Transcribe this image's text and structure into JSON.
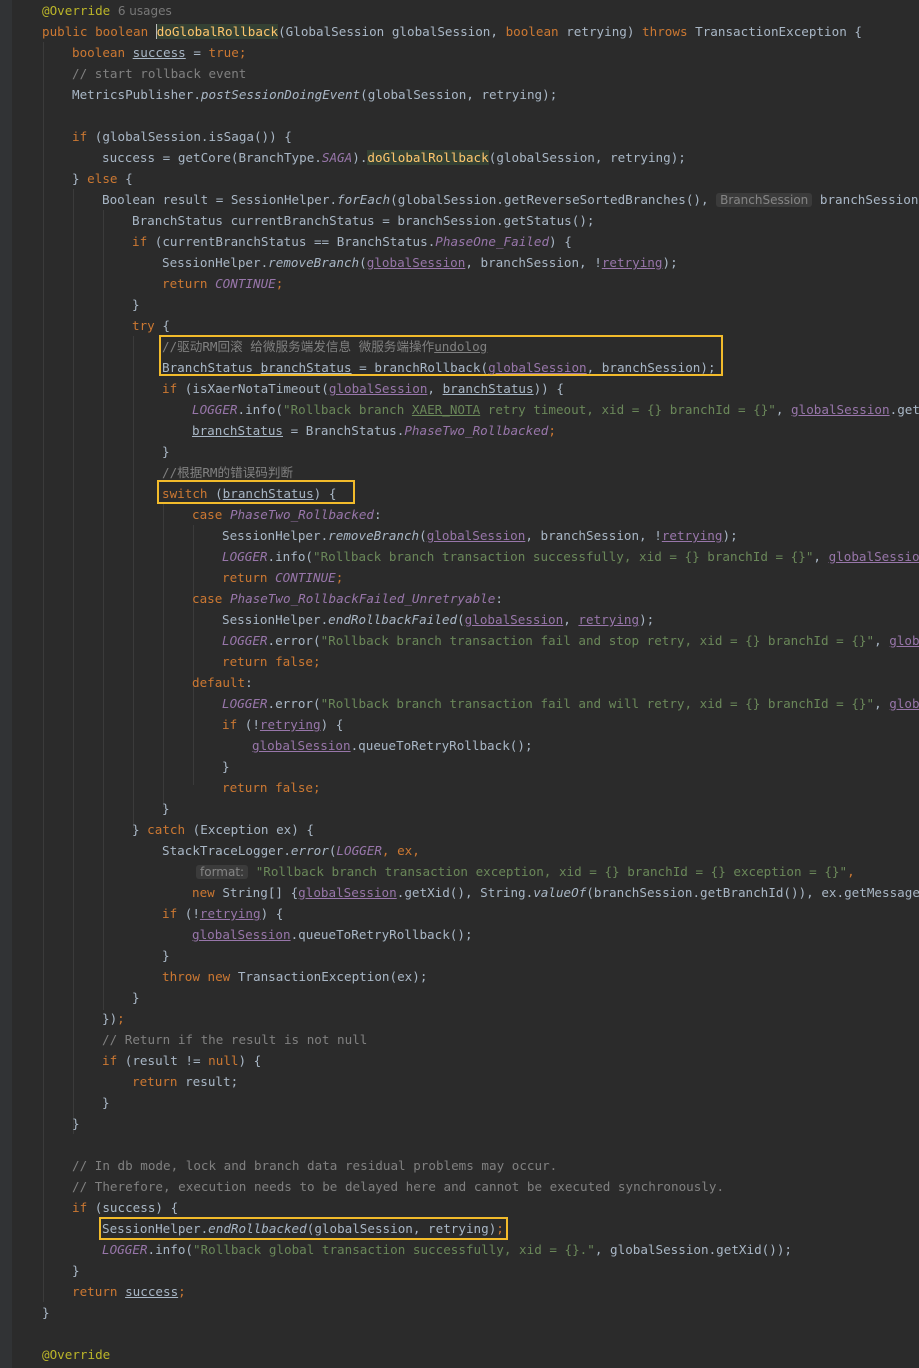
{
  "editor": {
    "usages_hint": "6 usages",
    "param_hint_branch": "BranchSession",
    "param_hint_format": "format:",
    "l1_annotation": "@Override",
    "l2_public": "public",
    "l2_boolean": "boolean",
    "l2_method": "doGlobalRollback",
    "l2_params_a": "(GlobalSession globalSession, ",
    "l2_boolean2": "boolean",
    "l2_params_b": " retrying) ",
    "l2_throws": "throws",
    "l2_rest": " TransactionException {",
    "l3_type": "boolean",
    "l3_var": "success",
    "l3_eq": " = ",
    "l3_true": "true",
    "l3_end": ";",
    "l4_comment": "// start rollback event",
    "l5_cls": "MetricsPublisher.",
    "l5_method": "postSessionDoingEvent",
    "l5_rest": "(globalSession, retrying);",
    "l7_if": "if",
    "l7_rest": " (globalSession.isSaga()) {",
    "l8_a": "success = getCore(BranchType.",
    "l8_saga": "SAGA",
    "l8_b": ").",
    "l8_method": "doGlobalRollback",
    "l8_c": "(globalSession, retrying);",
    "l9_a": "} ",
    "l9_else": "else",
    "l9_b": " {",
    "l10_a": "Boolean result = SessionHelper.",
    "l10_method": "forEach",
    "l10_b": "(globalSession.getReverseSortedBranches(), ",
    "l10_c": " branchSession",
    "l11": "BranchStatus currentBranchStatus = branchSession.getStatus();",
    "l12_if": "if",
    "l12_a": " (currentBranchStatus == BranchStatus.",
    "l12_const": "PhaseOne_Failed",
    "l12_b": ") {",
    "l13_a": "SessionHelper.",
    "l13_method": "removeBranch",
    "l13_b": "(",
    "l13_gs": "globalSession",
    "l13_c": ", branchSession, !",
    "l13_retry": "retrying",
    "l13_d": ");",
    "l14_return": "return",
    "l14_const": "CONTINUE",
    "l14_end": ";",
    "l15": "}",
    "l16_try": "try",
    "l16_b": " {",
    "l17_comment": "//驱动RM回滚 给微服务端发信息 微服务端操作",
    "l17_undolog": "undolog",
    "l18_a": "BranchStatus ",
    "l18_var": "branchStatus",
    "l18_b": " = branchRollback(",
    "l18_gs": "globalSession",
    "l18_c": ", branchSession);",
    "l19_if": "if",
    "l19_a": " (isXaerNotaTimeout(",
    "l19_gs": "globalSession",
    "l19_b": ", ",
    "l19_bs": "branchStatus",
    "l19_c": ")) {",
    "l20_logger": "LOGGER",
    "l20_a": ".info(",
    "l20_str1": "\"Rollback branch ",
    "l20_str_xaer": "XAER_NOTA",
    "l20_str2": " retry timeout, xid = {} branchId = {}\"",
    "l20_b": ", ",
    "l20_gs": "globalSession",
    "l20_c": ".getX",
    "l21_bs": "branchStatus",
    "l21_a": " = BranchStatus.",
    "l21_const": "PhaseTwo_Rollbacked",
    "l21_end": ";",
    "l22": "}",
    "l23_comment": "//根据RM的错误码判断",
    "l24_switch": "switch",
    "l24_a": " (",
    "l24_bs": "branchStatus",
    "l24_b": ") {",
    "l25_case": "case",
    "l25_const": "PhaseTwo_Rollbacked",
    "l25_b": ":",
    "l26_a": "SessionHelper.",
    "l26_method": "removeBranch",
    "l26_b": "(",
    "l26_gs": "globalSession",
    "l26_c": ", branchSession, !",
    "l26_retry": "retrying",
    "l26_d": ");",
    "l27_logger": "LOGGER",
    "l27_a": ".info(",
    "l27_str": "\"Rollback branch transaction successfully, xid = {} branchId = {}\"",
    "l27_b": ", ",
    "l27_gs": "globalSession",
    "l28_return": "return",
    "l28_const": "CONTINUE",
    "l28_end": ";",
    "l29_case": "case",
    "l29_const": "PhaseTwo_RollbackFailed_Unretryable",
    "l29_b": ":",
    "l30_a": "SessionHelper.",
    "l30_method": "endRollbackFailed",
    "l30_b": "(",
    "l30_gs": "globalSession",
    "l30_c": ", ",
    "l30_retry": "retrying",
    "l30_d": ");",
    "l31_logger": "LOGGER",
    "l31_a": ".error(",
    "l31_str": "\"Rollback branch transaction fail and stop retry, xid = {} branchId = {}\"",
    "l31_b": ", ",
    "l31_gs": "globa",
    "l32_return": "return",
    "l32_false": "false",
    "l32_end": ";",
    "l33_default": "default",
    "l33_b": ":",
    "l34_logger": "LOGGER",
    "l34_a": ".error(",
    "l34_str": "\"Rollback branch transaction fail and will retry, xid = {} branchId = {}\"",
    "l34_b": ", ",
    "l34_gs": "globa",
    "l35_if": "if",
    "l35_a": " (!",
    "l35_retry": "retrying",
    "l35_b": ") {",
    "l36_gs": "globalSession",
    "l36_a": ".queueToRetryRollback();",
    "l37": "}",
    "l38_return": "return",
    "l38_false": "false",
    "l38_end": ";",
    "l39": "}",
    "l40_a": "} ",
    "l40_catch": "catch",
    "l40_b": " (Exception ex) {",
    "l41_a": "StackTraceLogger.",
    "l41_method": "error",
    "l41_b": "(",
    "l41_logger": "LOGGER",
    "l41_c": ", ex,",
    "l42_str": "\"Rollback branch transaction exception, xid = {} branchId = {} exception = {}\"",
    "l42_end": ",",
    "l43_new": "new",
    "l43_a": " String[] {",
    "l43_gs": "globalSession",
    "l43_b": ".getXid(), String.",
    "l43_method": "valueOf",
    "l43_c": "(branchSession.getBranchId()), ex.getMessage",
    "l44_if": "if",
    "l44_a": " (!",
    "l44_retry": "retrying",
    "l44_b": ") {",
    "l45_gs": "globalSession",
    "l45_a": ".queueToRetryRollback();",
    "l46": "}",
    "l47_throw": "throw",
    "l47_new": "new",
    "l47_a": " TransactionException(ex);",
    "l48": "}",
    "l49_a": "})",
    "l49_b": ";",
    "l50_comment": "// Return if the result is not null",
    "l51_if": "if",
    "l51_a": " (result != ",
    "l51_null": "null",
    "l51_b": ") {",
    "l52_return": "return",
    "l52_a": " result;",
    "l53": "}",
    "l54": "}",
    "l56_comment": "// In db mode, lock and branch data residual problems may occur.",
    "l57_comment": "// Therefore, execution needs to be delayed here and cannot be executed synchronously.",
    "l58_if": "if",
    "l58_a": " (success) {",
    "l59_a": "SessionHelper.",
    "l59_method": "endRollbacked",
    "l59_b": "(globalSession, retrying)",
    "l59_end": ";",
    "l60_logger": "LOGGER",
    "l60_a": ".info(",
    "l60_str": "\"Rollback global transaction successfully, xid = {}.\"",
    "l60_b": ", globalSession.getXid());",
    "l61": "}",
    "l62_return": "return",
    "l62_var": "success",
    "l62_end": ";",
    "l63": "}",
    "l65_annotation": "@Override"
  }
}
